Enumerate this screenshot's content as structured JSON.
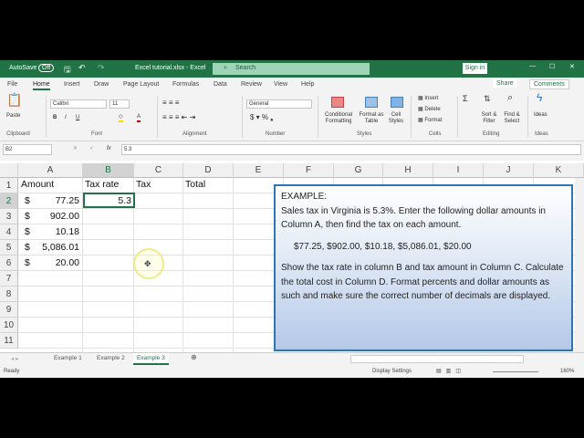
{
  "titlebar": {
    "autosave": "AutoSave",
    "autosave_state": "Off",
    "filename": "Excel tutorial.xlsx - Excel",
    "search": "Search",
    "signin": "Sign in"
  },
  "tabs": [
    "File",
    "Home",
    "Insert",
    "Draw",
    "Page Layout",
    "Formulas",
    "Data",
    "Review",
    "View",
    "Help"
  ],
  "share": "Share",
  "comments": "Comments",
  "ribbon": {
    "paste": "Paste",
    "clipboard": "Clipboard",
    "font_name": "Calibri",
    "font_size": "11",
    "font": "Font",
    "alignment": "Alignment",
    "number_format": "General",
    "number": "Number",
    "cond_fmt": "Conditional Formatting",
    "fmt_table": "Format as Table",
    "cell_styles": "Cell Styles",
    "styles": "Styles",
    "insert": "Insert",
    "delete": "Delete",
    "format": "Format",
    "cells": "Cells",
    "sort": "Sort & Filter",
    "find": "Find & Select",
    "editing": "Editing",
    "ideas": "Ideas",
    "ideas_group": "Ideas",
    "bold": "B",
    "italic": "I",
    "underline": "U"
  },
  "formula": {
    "namebox": "B2",
    "fx": "fx",
    "value": "5.3"
  },
  "columns": [
    "A",
    "B",
    "C",
    "D",
    "E",
    "F",
    "G",
    "H",
    "I",
    "J",
    "K"
  ],
  "rows": [
    "1",
    "2",
    "3",
    "4",
    "5",
    "6",
    "7",
    "8",
    "9",
    "10",
    "11"
  ],
  "cells": {
    "A1": "Amount",
    "B1": "Tax rate",
    "C1": "Tax",
    "D1": "Total",
    "B2": "5.3",
    "amounts": [
      {
        "sym": "$",
        "val": "77.25"
      },
      {
        "sym": "$",
        "val": "902.00"
      },
      {
        "sym": "$",
        "val": "10.18"
      },
      {
        "sym": "$",
        "val": "5,086.01"
      },
      {
        "sym": "$",
        "val": "20.00"
      }
    ]
  },
  "textbox": {
    "heading": "EXAMPLE:",
    "p1": "Sales tax in Virginia is 5.3%. Enter the following dollar amounts in Column A, then find the tax on each amount.",
    "p2": "$77.25, $902.00, $10.18, $5,086.01, $20.00",
    "p3": "Show the tax rate in column B and tax amount in Column C. Calculate the total cost in Column D. Format percents and dollar amounts as such and make sure the correct number of decimals are displayed."
  },
  "sheets": [
    "Example 1",
    "Example 2",
    "Example 3"
  ],
  "status": {
    "ready": "Ready",
    "display": "Display Settings",
    "zoom": "160%"
  }
}
